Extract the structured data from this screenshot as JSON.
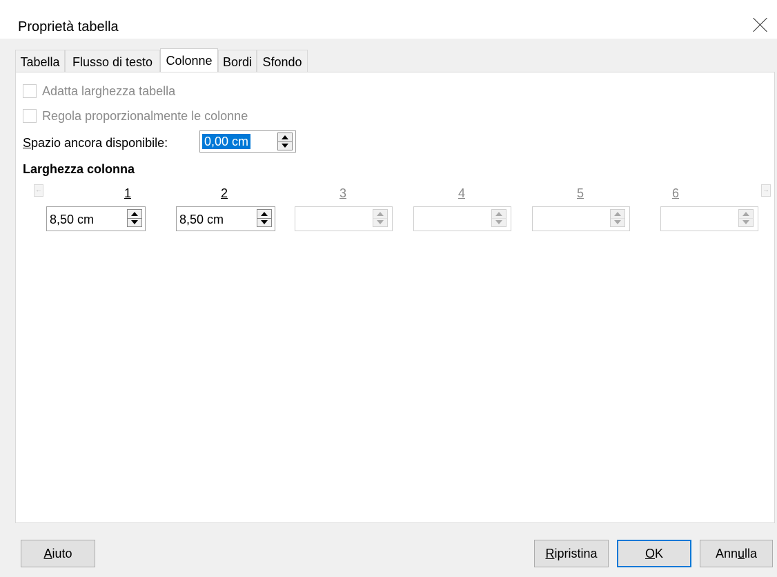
{
  "window": {
    "title": "Proprietà tabella"
  },
  "tabs": [
    {
      "label": "Tabella",
      "active": false
    },
    {
      "label": "Flusso di testo",
      "active": false
    },
    {
      "label": "Colonne",
      "active": true
    },
    {
      "label": "Bordi",
      "active": false
    },
    {
      "label": "Sfondo",
      "active": false
    }
  ],
  "options": {
    "fit_width": {
      "label_pre": "Adatta lar",
      "label_ul": "g",
      "label_post": "hezza tabella",
      "checked": false,
      "enabled": false
    },
    "adjust_prop": {
      "label_pre": "Re",
      "label_ul": "g",
      "label_post": "ola proporzionalmente le colonne",
      "checked": false,
      "enabled": false
    }
  },
  "remaining": {
    "label_ul": "S",
    "label_post": "pazio ancora disponibile:",
    "value": "0,00 cm"
  },
  "column_width": {
    "heading": "Larghezza colonna",
    "columns": [
      {
        "number": "1",
        "value": "8,50 cm",
        "enabled": true
      },
      {
        "number": "2",
        "value": "8,50 cm",
        "enabled": true
      },
      {
        "number": "3",
        "value": "",
        "enabled": false
      },
      {
        "number": "4",
        "value": "",
        "enabled": false
      },
      {
        "number": "5",
        "value": "",
        "enabled": false
      },
      {
        "number": "6",
        "value": "",
        "enabled": false
      }
    ]
  },
  "buttons": {
    "help_ul": "A",
    "help_post": "iuto",
    "reset_ul": "R",
    "reset_post": "ipristina",
    "ok_ul": "O",
    "ok_post": "K",
    "cancel_pre": "Ann",
    "cancel_ul": "u",
    "cancel_post": "lla"
  },
  "colors": {
    "accent": "#0078d7",
    "disabled_text": "#8a8a8a"
  }
}
